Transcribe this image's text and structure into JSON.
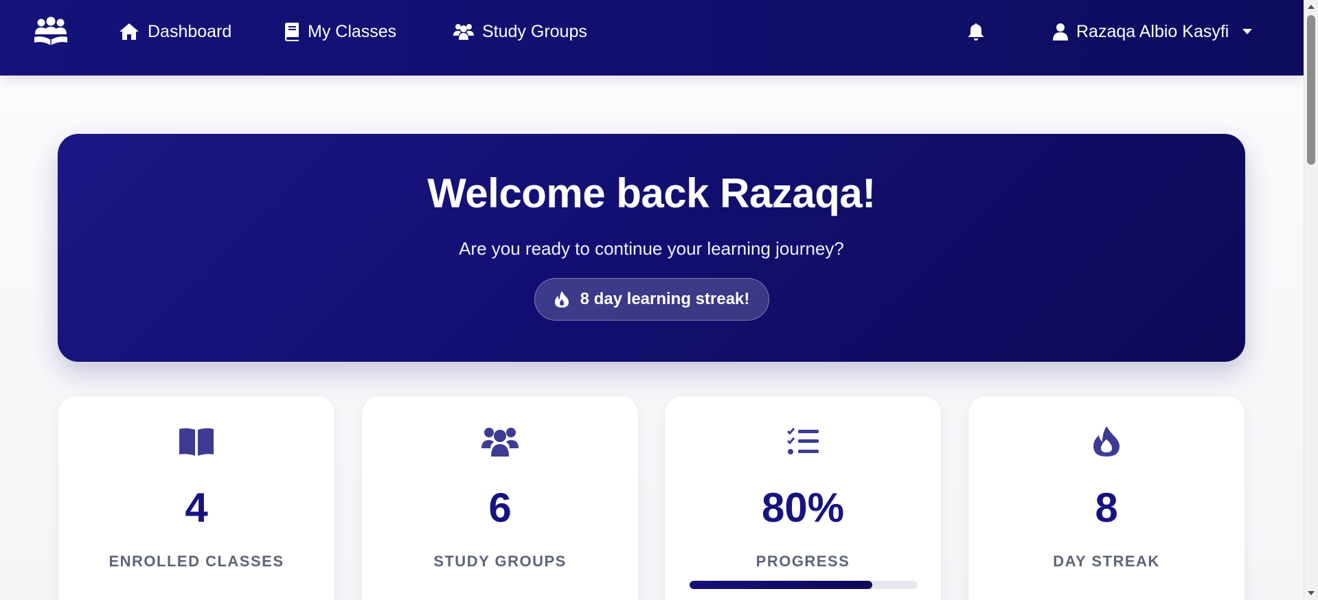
{
  "nav": {
    "links": [
      {
        "label": "Dashboard",
        "icon": "home-icon"
      },
      {
        "label": "My Classes",
        "icon": "book-icon"
      },
      {
        "label": "Study Groups",
        "icon": "users-icon"
      }
    ],
    "notification_icon": "bell-icon",
    "user": {
      "name": "Razaqa Albio Kasyfi",
      "icon": "user-icon"
    }
  },
  "hero": {
    "title": "Welcome back Razaqa!",
    "subtitle": "Are you ready to continue your learning journey?",
    "streak_text": "8 day learning streak!"
  },
  "stats": [
    {
      "value": "4",
      "label": "ENROLLED CLASSES",
      "icon": "open-book-icon"
    },
    {
      "value": "6",
      "label": "STUDY GROUPS",
      "icon": "users-icon"
    },
    {
      "value": "80%",
      "label": "PROGRESS",
      "icon": "tasks-list-icon",
      "progress": 0.8
    },
    {
      "value": "8",
      "label": "DAY STREAK",
      "icon": "fire-icon"
    }
  ],
  "colors": {
    "primary": "#15137a",
    "primary_dark": "#0e0a58",
    "accent_icon": "#3d3b93",
    "label_gray": "#5d6477"
  }
}
